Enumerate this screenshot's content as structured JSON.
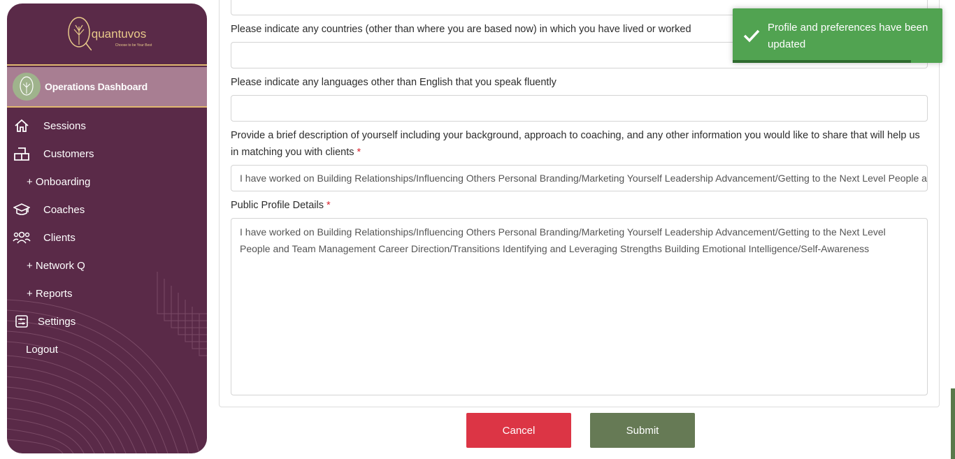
{
  "sidebar": {
    "logo_text": "quantuvos",
    "logo_tagline": "Choose to be Your Best",
    "operations_label": "Operations Dashboard",
    "items": [
      {
        "label": "Sessions"
      },
      {
        "label": "Customers"
      },
      {
        "label": "+ Onboarding"
      },
      {
        "label": "Coaches"
      },
      {
        "label": "Clients"
      },
      {
        "label": "+ Network Q"
      },
      {
        "label": "+ Reports"
      },
      {
        "label": "Settings"
      },
      {
        "label": "Logout"
      }
    ]
  },
  "form": {
    "countries_label": "Please indicate any countries (other than where you are based now) in which you have lived or worked",
    "countries_value": "",
    "languages_label": "Please indicate any languages other than English that you speak fluently",
    "languages_value": "",
    "description_label": "Provide a brief description of yourself including your background, approach to coaching, and any other information you would like to share that will help us in matching you with clients",
    "description_value": "I have worked on Building Relationships/Influencing Others Personal Branding/Marketing Yourself Leadership Advancement/Getting to the Next Level People and Team Management Career Direction/Transitions Identifying and Leveraging Strengths Building Emotional Intelligence/Self-Awareness",
    "public_profile_label": "Public Profile Details",
    "public_profile_value": "I have worked on Building Relationships/Influencing Others Personal Branding/Marketing Yourself Leadership Advancement/Getting to the Next Level People and Team Management Career Direction/Transitions Identifying and Leveraging Strengths Building Emotional Intelligence/Self-Awareness",
    "required_mark": "*"
  },
  "actions": {
    "cancel_label": "Cancel",
    "submit_label": "Submit"
  },
  "toast": {
    "message": "Profile and preferences have been updated",
    "progress": 0.85
  },
  "colors": {
    "sidebar_bg": "#5a2a48",
    "accent_gold": "#e0b870",
    "cancel": "#dc3545",
    "submit": "#667a55",
    "toast": "#51a351"
  }
}
